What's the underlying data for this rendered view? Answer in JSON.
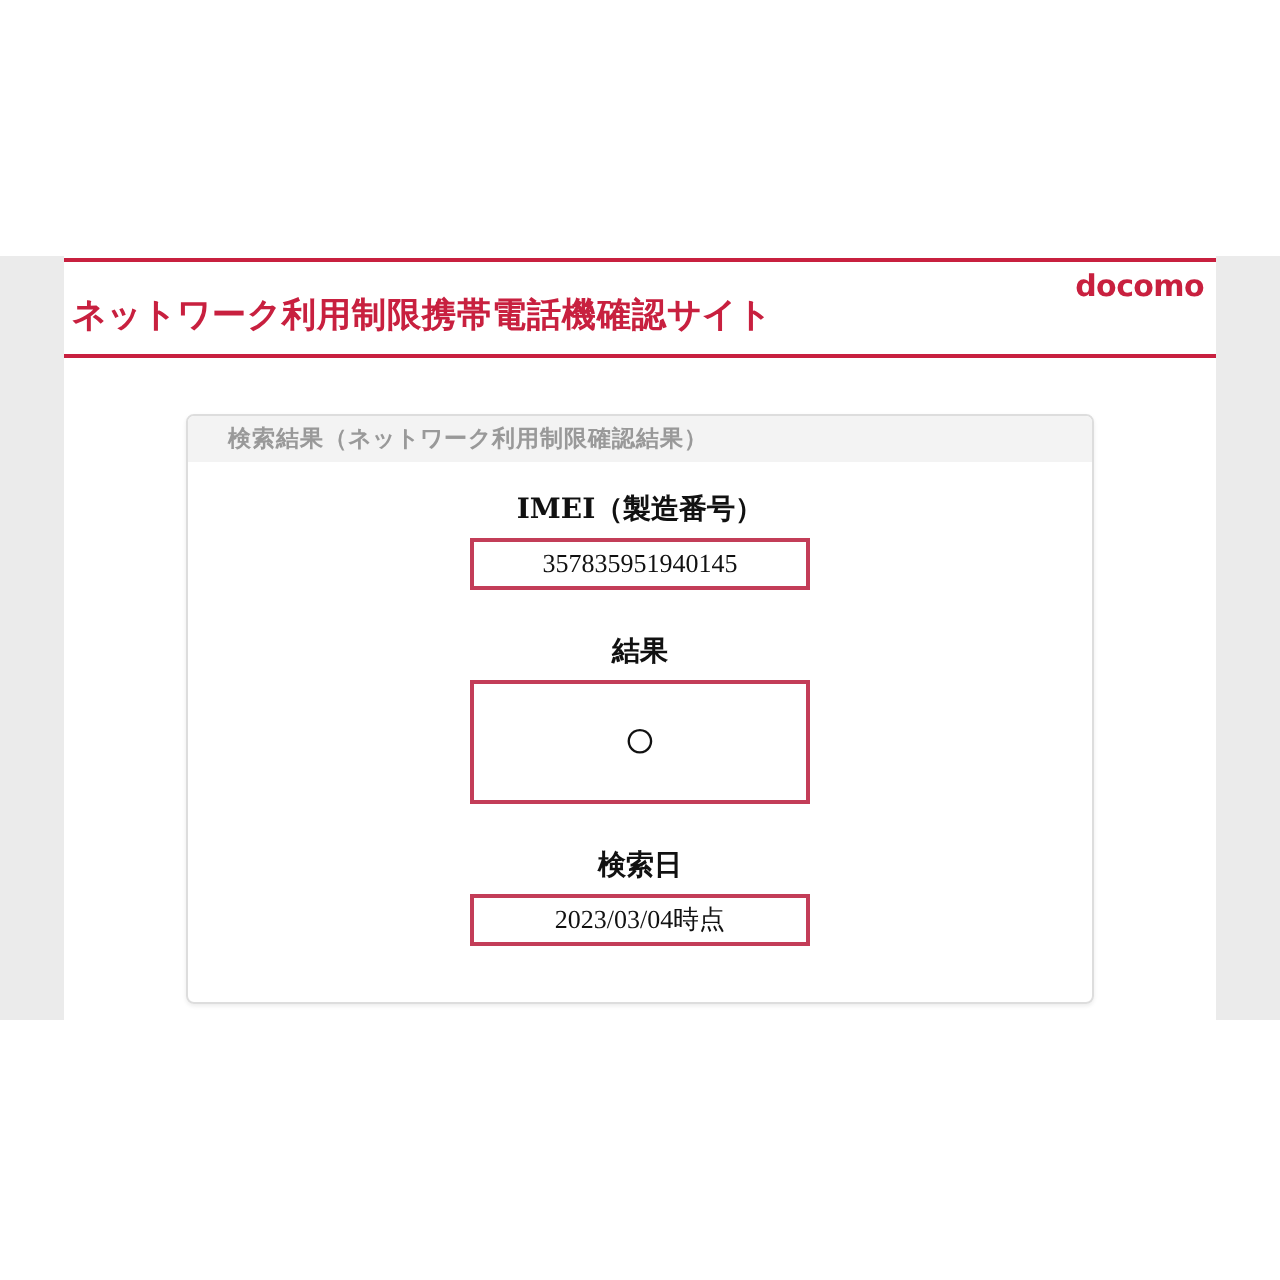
{
  "header": {
    "title": "ネットワーク利用制限携帯電話機確認サイト",
    "logo": "docomo"
  },
  "result_panel": {
    "title": "検索結果（ネットワーク利用制限確認結果）",
    "fields": [
      {
        "kind": "value",
        "label": "IMEI（製造番号）",
        "value": "357835951940145"
      },
      {
        "kind": "mark",
        "label": "結果",
        "value": "○"
      },
      {
        "kind": "value",
        "label": "検索日",
        "value": "2023/03/04時点"
      }
    ]
  }
}
